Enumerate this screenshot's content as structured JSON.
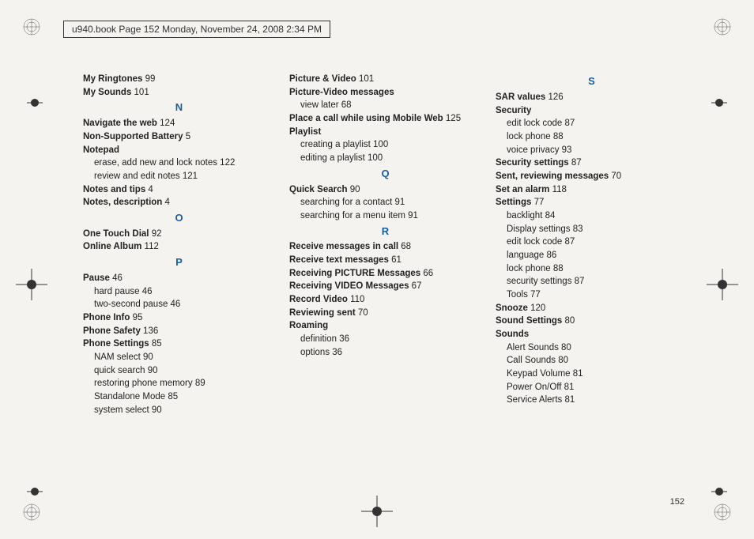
{
  "header": "u940.book  Page 152  Monday, November 24, 2008  2:34 PM",
  "page_number": "152",
  "columns": [
    [
      {
        "type": "main",
        "bold": "My Ringtones",
        "page": "99"
      },
      {
        "type": "main",
        "bold": "My Sounds",
        "page": "101"
      },
      {
        "type": "letter",
        "text": "N"
      },
      {
        "type": "main",
        "bold": "Navigate the web",
        "page": "124"
      },
      {
        "type": "main",
        "bold": "Non-Supported Battery",
        "page": "5"
      },
      {
        "type": "main",
        "bold": "Notepad",
        "page": ""
      },
      {
        "type": "sub",
        "text": "erase, add new and lock notes",
        "page": "122"
      },
      {
        "type": "sub",
        "text": "review and edit notes",
        "page": "121"
      },
      {
        "type": "main",
        "bold": "Notes and tips",
        "page": "4"
      },
      {
        "type": "main",
        "bold": "Notes, description",
        "page": "4"
      },
      {
        "type": "letter",
        "text": "O"
      },
      {
        "type": "main",
        "bold": "One Touch Dial",
        "page": "92"
      },
      {
        "type": "main",
        "bold": "Online Album",
        "page": "112"
      },
      {
        "type": "letter",
        "text": "P"
      },
      {
        "type": "main",
        "bold": "Pause",
        "page": "46"
      },
      {
        "type": "sub",
        "text": "hard pause",
        "page": "46"
      },
      {
        "type": "sub",
        "text": "two-second pause",
        "page": "46"
      },
      {
        "type": "main",
        "bold": "Phone Info",
        "page": "95"
      },
      {
        "type": "main",
        "bold": "Phone Safety",
        "page": "136"
      },
      {
        "type": "main",
        "bold": "Phone Settings",
        "page": "85"
      },
      {
        "type": "sub",
        "text": "NAM select",
        "page": "90"
      },
      {
        "type": "sub",
        "text": "quick search",
        "page": "90"
      },
      {
        "type": "sub",
        "text": "restoring phone memory",
        "page": "89"
      },
      {
        "type": "sub",
        "text": "Standalone Mode",
        "page": "85"
      },
      {
        "type": "sub",
        "text": "system select",
        "page": "90"
      }
    ],
    [
      {
        "type": "main",
        "bold": "Picture & Video",
        "page": "101"
      },
      {
        "type": "main",
        "bold": "Picture-Video messages",
        "page": ""
      },
      {
        "type": "sub",
        "text": "view later",
        "page": "68"
      },
      {
        "type": "main",
        "bold": "Place a call while using Mobile Web",
        "page": "125"
      },
      {
        "type": "main",
        "bold": "Playlist",
        "page": ""
      },
      {
        "type": "sub",
        "text": "creating a playlist",
        "page": "100"
      },
      {
        "type": "sub",
        "text": "editing a playlist",
        "page": "100"
      },
      {
        "type": "letter",
        "text": "Q"
      },
      {
        "type": "main",
        "bold": "Quick Search",
        "page": "90"
      },
      {
        "type": "sub",
        "text": "searching for a contact",
        "page": "91"
      },
      {
        "type": "sub",
        "text": "searching for a menu item",
        "page": "91"
      },
      {
        "type": "letter",
        "text": "R"
      },
      {
        "type": "main",
        "bold": "Receive messages in call",
        "page": "68"
      },
      {
        "type": "main",
        "bold": "Receive text messages",
        "page": "61"
      },
      {
        "type": "main",
        "bold": "Receiving PICTURE Messages",
        "page": "66"
      },
      {
        "type": "main",
        "bold": "Receiving VIDEO Messages",
        "page": "67"
      },
      {
        "type": "main",
        "bold": "Record Video",
        "page": "110"
      },
      {
        "type": "main",
        "bold": "Reviewing sent",
        "page": "70"
      },
      {
        "type": "main",
        "bold": "Roaming",
        "page": ""
      },
      {
        "type": "sub",
        "text": "definition",
        "page": "36"
      },
      {
        "type": "sub",
        "text": "options",
        "page": "36"
      }
    ],
    [
      {
        "type": "letter",
        "text": "S"
      },
      {
        "type": "main",
        "bold": "SAR values",
        "page": "126"
      },
      {
        "type": "main",
        "bold": "Security",
        "page": ""
      },
      {
        "type": "sub",
        "text": "edit lock code",
        "page": "87"
      },
      {
        "type": "sub",
        "text": "lock phone",
        "page": "88"
      },
      {
        "type": "sub",
        "text": "voice privacy",
        "page": "93"
      },
      {
        "type": "main",
        "bold": "Security settings",
        "page": "87"
      },
      {
        "type": "main",
        "bold": "Sent, reviewing messages",
        "page": "70"
      },
      {
        "type": "main",
        "bold": "Set an alarm",
        "page": "118"
      },
      {
        "type": "main",
        "bold": "Settings",
        "page": "77"
      },
      {
        "type": "sub",
        "text": "backlight",
        "page": "84"
      },
      {
        "type": "sub",
        "text": "Display settings",
        "page": "83"
      },
      {
        "type": "sub",
        "text": "edit lock code",
        "page": "87"
      },
      {
        "type": "sub",
        "text": "language",
        "page": "86"
      },
      {
        "type": "sub",
        "text": "lock phone",
        "page": "88"
      },
      {
        "type": "sub",
        "text": "security settings",
        "page": "87"
      },
      {
        "type": "sub",
        "text": "Tools",
        "page": "77"
      },
      {
        "type": "main",
        "bold": "Snooze",
        "page": "120"
      },
      {
        "type": "main",
        "bold": "Sound Settings",
        "page": "80"
      },
      {
        "type": "main",
        "bold": "Sounds",
        "page": ""
      },
      {
        "type": "sub",
        "text": "Alert Sounds",
        "page": "80"
      },
      {
        "type": "sub",
        "text": "Call Sounds",
        "page": "80"
      },
      {
        "type": "sub",
        "text": "Keypad Volume",
        "page": "81"
      },
      {
        "type": "sub",
        "text": "Power On/Off",
        "page": "81"
      },
      {
        "type": "sub",
        "text": "Service Alerts",
        "page": "81"
      }
    ]
  ]
}
